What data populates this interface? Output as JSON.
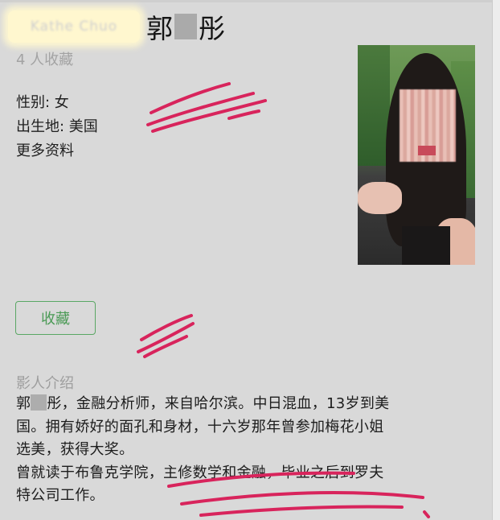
{
  "profile": {
    "name_prefix_blurred": "Kathe Chuo",
    "name_first": "郭",
    "name_last": "彤",
    "favorite_count": "4 人收藏",
    "gender": "性别: 女",
    "birthplace": "出生地: 美国",
    "more_info": "更多资料"
  },
  "actions": {
    "favorite_button": "收藏"
  },
  "bio": {
    "section_title": "影人介绍",
    "line1_before": "郭",
    "line1_after": "彤，金融分析师，来自哈尔滨。中日混血，13岁到美",
    "line2": "国。拥有娇好的面孔和身材，十六岁那年曾参加梅花小姐",
    "line3": "选美，获得大奖。",
    "line4": "曾就读于布鲁克学院，主修数学和金融，毕业之后到罗夫",
    "line5": "特公司工作。"
  },
  "colors": {
    "background": "#d9d9d9",
    "button_accent": "#4a9a55",
    "annotation": "#d8245c"
  }
}
